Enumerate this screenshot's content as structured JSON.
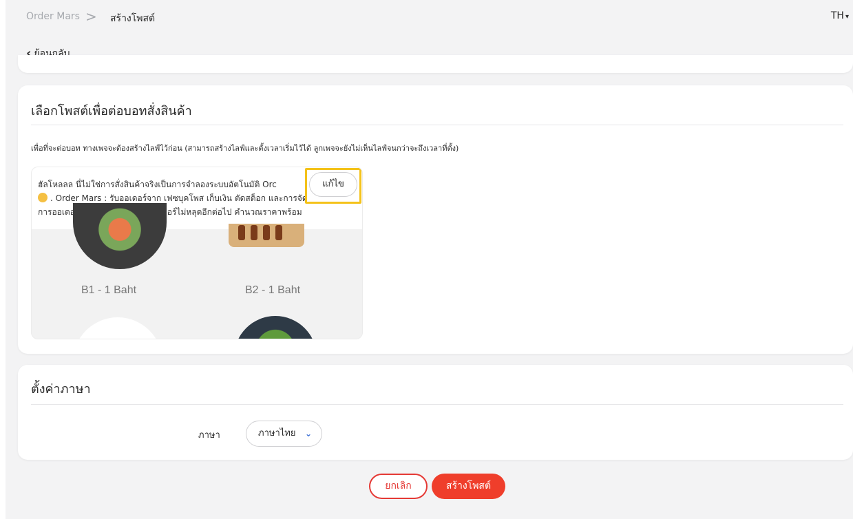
{
  "breadcrumb": {
    "root": "Order Mars",
    "separator": ">",
    "current": "สร้างโพสต์"
  },
  "language_switch": {
    "label": "TH",
    "caret": "▾"
  },
  "back": {
    "icon": "chevron-left-icon",
    "label": "ย้อนกลับ"
  },
  "post_section": {
    "title": "เลือกโพสต์เพื่อต่อบอทสั่งสินค้า",
    "hint": "เพื่อที่จะต่อบอท ทางเพจจะต้องสร้างไลฟ์ไว้ก่อน (สามารถสร้างไลฟ์และตั้งเวลาเริ่มไว้ได้ ลูกเพจจะยังไม่เห็นไลฟ์จนกว่าจะถึงเวลาที่ตั้ง)",
    "post": {
      "line1": "ฮัลโหลลล นี่ไม่ใช่การสั่งสินค้าจริงเป็นการจำลองระบบอัตโนมัติ Orc",
      "line2": ". Order Mars : รับออเดอร์จาก เฟซบุคโพส เก็บเงิน ตัดสต็อก และการจัด",
      "line3": "การออเดอร์ ในขั้นตอนเดียว . ออร์เดอร์ไม่หลุดอีกต่อไป คำนวณราคาพร้อม",
      "emoji": "face-emoji-icon",
      "edit_label": "แก้ไข",
      "items": [
        {
          "label": "B1 - 1 Baht"
        },
        {
          "label": "B2 - 1 Baht"
        }
      ]
    }
  },
  "language_section": {
    "title": "ตั้งค่าภาษา",
    "field_label": "ภาษา",
    "selected": "ภาษาไทย",
    "chevron": "❯"
  },
  "actions": {
    "cancel": "ยกเลิก",
    "create": "สร้างโพสต์"
  },
  "colors": {
    "accent_red": "#ef3e2b",
    "highlight_yellow": "#f4c21a",
    "link_blue": "#3b6fd6"
  }
}
